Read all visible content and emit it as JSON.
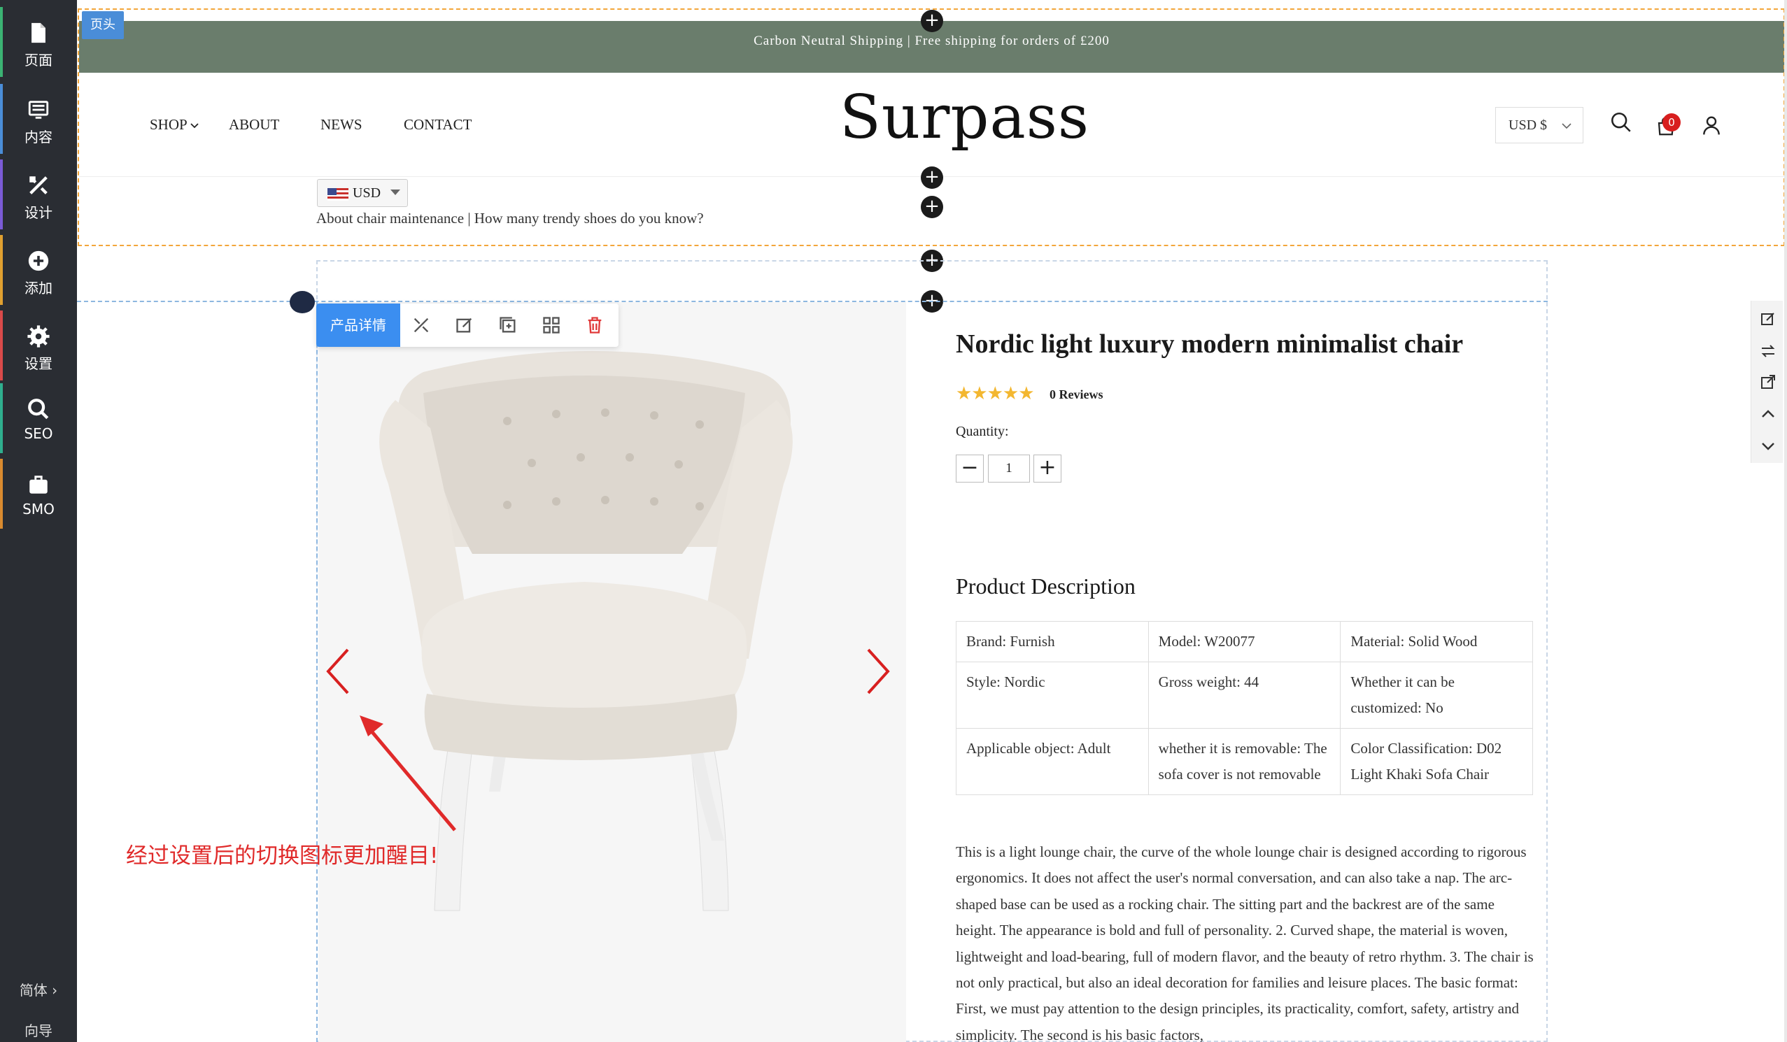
{
  "sidebar": {
    "items": [
      {
        "label": "页面",
        "icon": "page-icon"
      },
      {
        "label": "内容",
        "icon": "content-icon"
      },
      {
        "label": "设计",
        "icon": "design-icon"
      },
      {
        "label": "添加",
        "icon": "add-icon"
      },
      {
        "label": "设置",
        "icon": "settings-icon"
      },
      {
        "label": "SEO",
        "icon": "search-icon"
      },
      {
        "label": "SMO",
        "icon": "briefcase-icon"
      }
    ],
    "language": "简体 ›",
    "guide": "向导",
    "accent_colors": [
      "#3bb273",
      "#4a8dd8",
      "#7b5bd6",
      "#e0a030",
      "#d94a4a",
      "#2fae8e",
      "#d98a2f"
    ]
  },
  "header": {
    "tag": "页头",
    "announcement": "Carbon Neutral Shipping | Free shipping for orders of £200",
    "nav": [
      "SHOP",
      "ABOUT",
      "NEWS",
      "CONTACT"
    ],
    "logo": "Surpass",
    "currency": "USD $",
    "cart_count": "0",
    "currency_select": "USD",
    "links": "About chair maintenance | How many trendy shoes do you know?",
    "bar_color": "#6a7d6c"
  },
  "toolbar": {
    "label": "产品详情",
    "icons": [
      "design-icon",
      "edit-icon",
      "copy-icon",
      "grid-icon",
      "delete-icon"
    ]
  },
  "annotation": "经过设置后的切换图标更加醒目!",
  "product": {
    "title": "Nordic light luxury modern minimalist chair",
    "rating": 5,
    "reviews": "0 Reviews",
    "quantity_label": "Quantity:",
    "quantity": "1",
    "description_heading": "Product Description",
    "specs": [
      [
        "Brand: Furnish",
        "Model: W20077",
        "Material: Solid Wood"
      ],
      [
        "Style: Nordic",
        "Gross weight: 44",
        "Whether it can be customized: No"
      ],
      [
        "Applicable object: Adult",
        "whether it is removable: The sofa cover is not removable",
        "Color Classification: D02 Light Khaki Sofa Chair"
      ]
    ],
    "description": "This is a light lounge chair, the curve of the whole lounge chair is designed according to rigorous ergonomics. It does not affect the user's normal conversation, and can also take a nap. The arc-shaped base can be used as a rocking chair. The sitting part and the backrest are of the same height. The appearance is bold and full of personality. 2. Curved shape, the material is woven, lightweight and load-bearing, full of modern flavor, and the beauty of retro rhythm. 3. The chair is not only practical, but also an ideal decoration for families and leisure places. The basic format: First, we must pay attention to the design principles, its practicality, comfort, safety, artistry and simplicity. The second is his basic factors,"
  },
  "right_tools": [
    "edit-icon",
    "swap-icon",
    "external-link-icon",
    "chevron-up-icon",
    "chevron-down-icon"
  ]
}
